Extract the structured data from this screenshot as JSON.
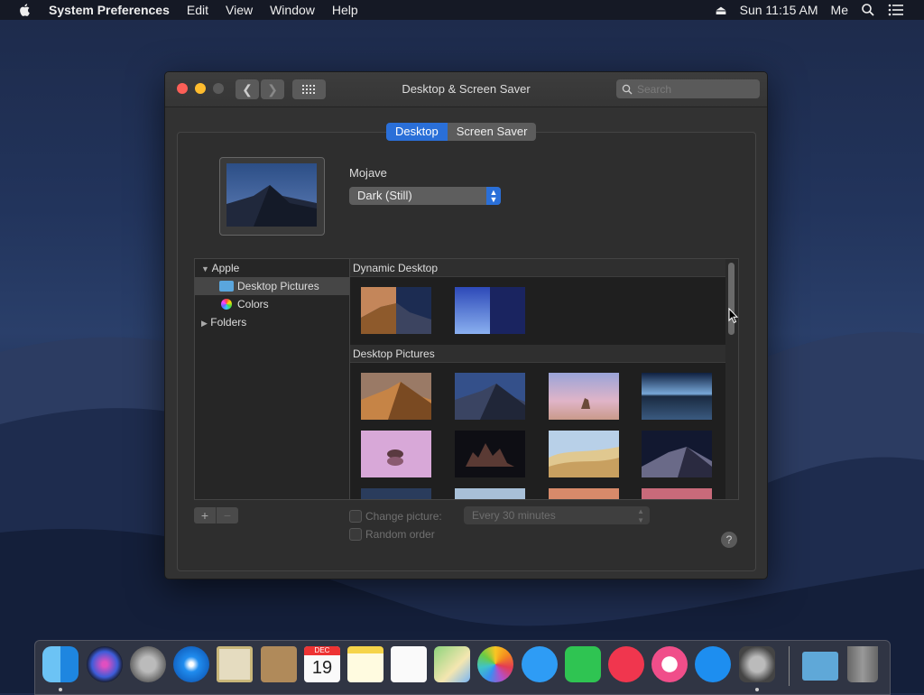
{
  "menubar": {
    "app_name": "System Preferences",
    "menus": [
      "Edit",
      "View",
      "Window",
      "Help"
    ],
    "clock": "Sun 11:15 AM",
    "user": "Me"
  },
  "window": {
    "title": "Desktop & Screen Saver",
    "search_placeholder": "Search",
    "tabs": [
      "Desktop",
      "Screen Saver"
    ],
    "selected_tab": "Desktop",
    "picture_name": "Mojave",
    "appearance_value": "Dark (Still)"
  },
  "sidebar": {
    "apple_label": "Apple",
    "items": [
      "Desktop Pictures",
      "Colors"
    ],
    "folders_label": "Folders"
  },
  "gallery": {
    "section_dynamic": "Dynamic Desktop",
    "section_pictures": "Desktop Pictures"
  },
  "options": {
    "change_picture_label": "Change picture:",
    "change_interval": "Every 30 minutes",
    "random_order_label": "Random order",
    "plus": "+",
    "minus": "−",
    "help": "?"
  },
  "colors": {
    "accent": "#2a6fd8",
    "close": "#fc5f57",
    "minimize": "#febc2e",
    "zoom": "#5a5a5a"
  },
  "dock": {
    "apps": [
      "finder-icon",
      "siri-icon",
      "launchpad-icon",
      "safari-icon",
      "mail-icon",
      "contacts-icon",
      "calendar-icon",
      "notes-icon",
      "reminders-icon",
      "maps-icon",
      "photos-icon",
      "messages-icon",
      "facetime-icon",
      "news-icon",
      "itunes-icon",
      "app-store-icon",
      "system-preferences-icon",
      "downloads-icon",
      "trash-icon"
    ],
    "calendar_month": "DEC",
    "calendar_day": "19"
  }
}
